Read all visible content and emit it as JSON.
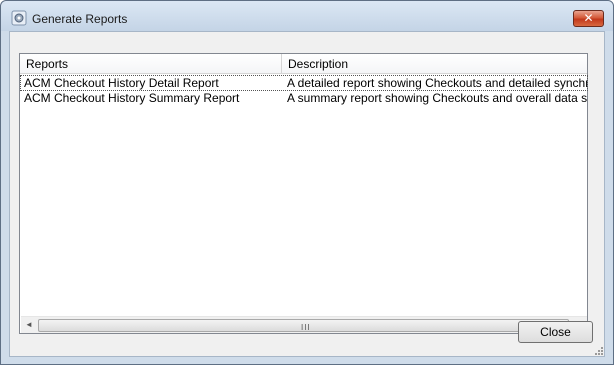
{
  "window": {
    "title": "Generate Reports",
    "close_glyph": "✕"
  },
  "list": {
    "columns": [
      "Reports",
      "Description"
    ],
    "rows": [
      {
        "report": "ACM Checkout History Detail Report",
        "description": "A detailed report showing Checkouts and detailed synchro..."
      },
      {
        "report": "ACM Checkout History Summary Report",
        "description": "A summary report showing Checkouts and overall data syn..."
      }
    ],
    "scrollbar": {
      "left_arrow": "◄",
      "right_arrow": "►",
      "grip": "III"
    }
  },
  "footer": {
    "close_label": "Close"
  },
  "icons": {
    "app": "gear-report-icon",
    "close": "close-icon",
    "resize": "resize-grip-icon"
  },
  "colors": {
    "titlebar": "#c4d4e6",
    "close_button": "#c2391c",
    "dialog_bg": "#f0f0f0"
  }
}
